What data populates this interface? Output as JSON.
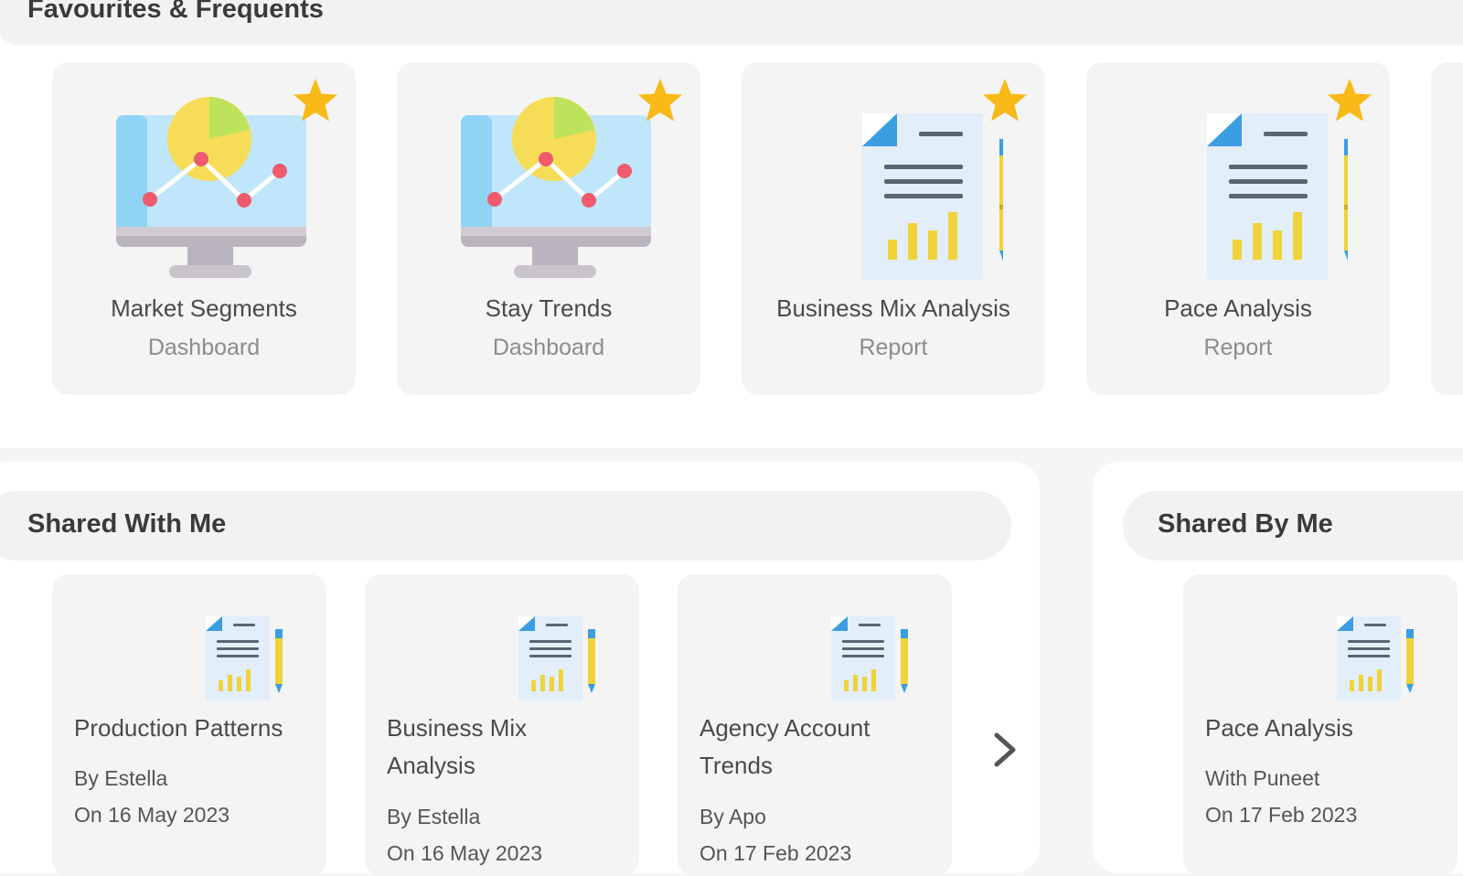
{
  "favourites": {
    "title": "Favourites & Frequents",
    "items": [
      {
        "title": "Market Segments",
        "type": "Dashboard",
        "icon": "monitor-chart-icon",
        "starred": true
      },
      {
        "title": "Stay Trends",
        "type": "Dashboard",
        "icon": "monitor-chart-icon",
        "starred": true
      },
      {
        "title": "Business Mix Analysis",
        "type": "Report",
        "icon": "report-document-icon",
        "starred": true
      },
      {
        "title": "Pace Analysis",
        "type": "Report",
        "icon": "report-document-icon",
        "starred": true
      }
    ]
  },
  "shared_with_me": {
    "title": "Shared With Me",
    "items": [
      {
        "title": "Production Patterns",
        "by": "By Estella",
        "on": "On 16 May 2023"
      },
      {
        "title": "Business Mix Analysis",
        "by": "By Estella",
        "on": "On 16 May 2023"
      },
      {
        "title": "Agency Account Trends",
        "by": "By Apo",
        "on": "On 17 Feb 2023"
      }
    ],
    "next_icon": "chevron-right-icon"
  },
  "shared_by_me": {
    "title": "Shared By Me",
    "items": [
      {
        "title": "Pace Analysis",
        "with": "With Puneet",
        "on": "On 17 Feb 2023"
      }
    ]
  },
  "colors": {
    "star": "#f9b916",
    "doc_blue": "#3b9ee3",
    "doc_paper": "#e2eef9",
    "bars": "#f0d33a",
    "monitor_screen": "#bfe6fb",
    "pie_yellow": "#f7dd57",
    "pie_green": "#bde35c",
    "line_points": "#ef5b6d"
  }
}
